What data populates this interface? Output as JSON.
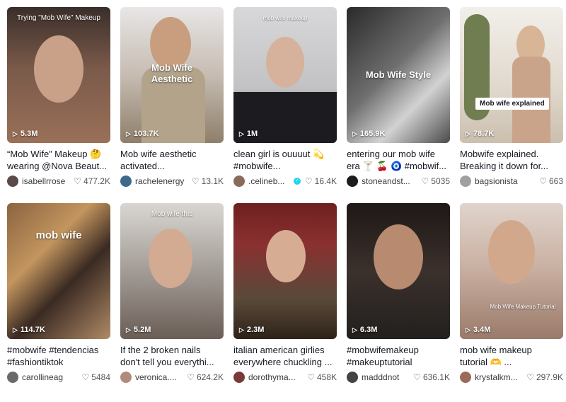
{
  "videos": [
    {
      "overlay": "Trying \"Mob Wife\" Makeup",
      "views": "5.3M",
      "caption1": "“Mob Wife” Makeup 🤔",
      "caption2": "wearing @Nova Beaut...",
      "user": "isabellrrose",
      "likes": "477.2K"
    },
    {
      "overlay": "Mob Wife Aesthetic",
      "views": "103.7K",
      "caption1": "Mob wife aesthetic",
      "caption2": "activated...",
      "user": "rachelenergy",
      "likes": "13.1K"
    },
    {
      "overlay": "mob wife makeup",
      "views": "1M",
      "caption1": "clean girl is ouuuut 💫",
      "caption2": "#mobwife...",
      "user": ".celineb...",
      "likes": "16.4K",
      "verified": "✓"
    },
    {
      "overlay": "Mob Wife Style",
      "views": "165.9K",
      "caption1": "entering our mob wife",
      "caption2": "era 🍸 🍒 🧿 #mobwif...",
      "user": "stoneandst...",
      "likes": "5035"
    },
    {
      "overlay": "Mob wife explained",
      "views": "78.7K",
      "caption1": "Mobwife explained.",
      "caption2": "Breaking it down for...",
      "user": "bagsionista",
      "likes": "663"
    },
    {
      "overlay": "mob wife",
      "views": "114.7K",
      "caption1": "#mobwife #tendencias",
      "caption2": "#fashiontiktok",
      "user": "carollineag",
      "likes": "5484"
    },
    {
      "overlay": "Mob wife this",
      "views": "5.2M",
      "caption1": "If the 2 broken nails",
      "caption2": "don't tell you everythi...",
      "user": "veronica....",
      "likes": "624.2K"
    },
    {
      "overlay": "",
      "views": "2.3M",
      "caption1": "italian american girlies",
      "caption2": "everywhere chuckling ...",
      "user": "dorothyma...",
      "likes": "458K"
    },
    {
      "overlay": "",
      "views": "6.3M",
      "caption1": "#mobwifemakeup",
      "caption2": "#makeuptutorial",
      "user": "madddnot",
      "likes": "636.1K"
    },
    {
      "overlay": "Mob Wife Makeup Tutorial",
      "views": "3.4M",
      "caption1": "mob wife makeup",
      "caption2": "tutorial 🫶 ...",
      "user": "krystalkm...",
      "likes": "297.9K"
    }
  ],
  "colors": {
    "thumbs": [
      "#7a5a4a",
      "#b7a79a",
      "#c9c9cb",
      "#5f5f5f",
      "#d8d0c4",
      "#6b5340",
      "#8e8a88",
      "#7a2a28",
      "#3b302c",
      "#c8aea0"
    ],
    "avatars": [
      "#5a4a4a",
      "#3c6a8a",
      "#8a6a5a",
      "#1c1c1c",
      "#a0a0a0",
      "#6a6a6a",
      "#b08a7a",
      "#7a3a3a",
      "#444444",
      "#9a6a5a"
    ]
  }
}
